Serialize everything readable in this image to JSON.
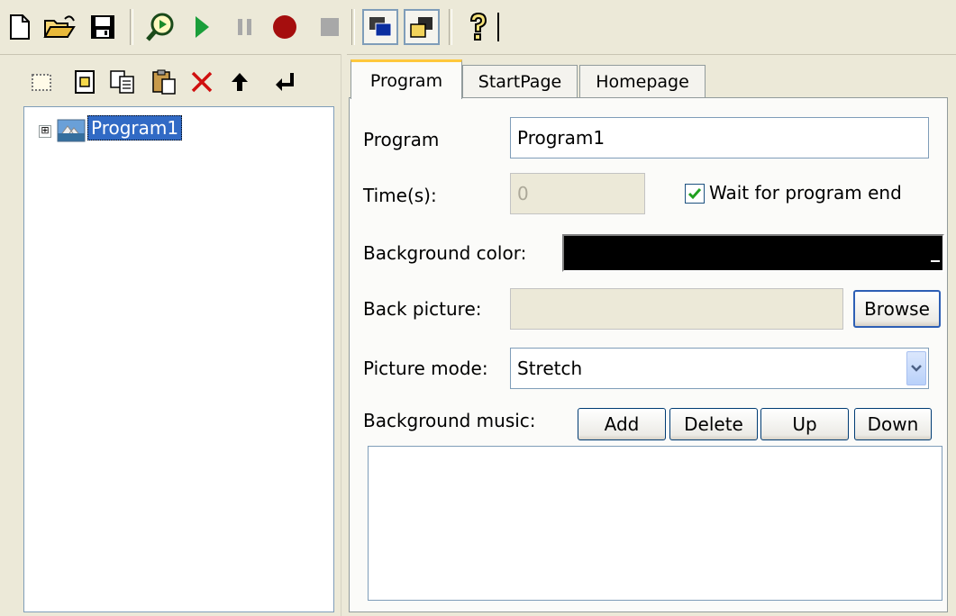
{
  "toolbar": {
    "icons": [
      "new-icon",
      "open-icon",
      "save-icon",
      "preview-icon",
      "play-icon",
      "pause-icon",
      "record-icon",
      "stop-icon",
      "window-mode-icon",
      "window-restore-icon",
      "help-icon"
    ]
  },
  "left_toolbar": {
    "icons": [
      "new-program-icon",
      "new-page-icon",
      "copy-icon",
      "paste-icon",
      "delete-icon",
      "move-up-icon",
      "move-down-icon"
    ]
  },
  "tree": {
    "items": [
      {
        "label": "Program1",
        "expander": "⊞",
        "selected": true
      }
    ]
  },
  "tabs": [
    {
      "label": "Program",
      "active": true
    },
    {
      "label": "StartPage",
      "active": false
    },
    {
      "label": "Homepage",
      "active": false
    }
  ],
  "form": {
    "program_label": "Program",
    "program_value": "Program1",
    "time_label": "Time(s):",
    "time_value": "0",
    "wait_label": "Wait for program end",
    "wait_checked": true,
    "bgcolor_label": "Background color:",
    "bgcolor_value": "#000000",
    "backpic_label": "Back picture:",
    "backpic_value": "",
    "browse_label": "Browse",
    "picmode_label": "Picture mode:",
    "picmode_value": "Stretch",
    "music_label": "Background music:",
    "music_buttons": [
      "Add",
      "Delete",
      "Up",
      "Down"
    ]
  },
  "colors": {
    "window_bg": "#ece9d8",
    "selection": "#316ac5",
    "tab_accent": "#ffc83c",
    "field_border": "#7f9db9"
  }
}
